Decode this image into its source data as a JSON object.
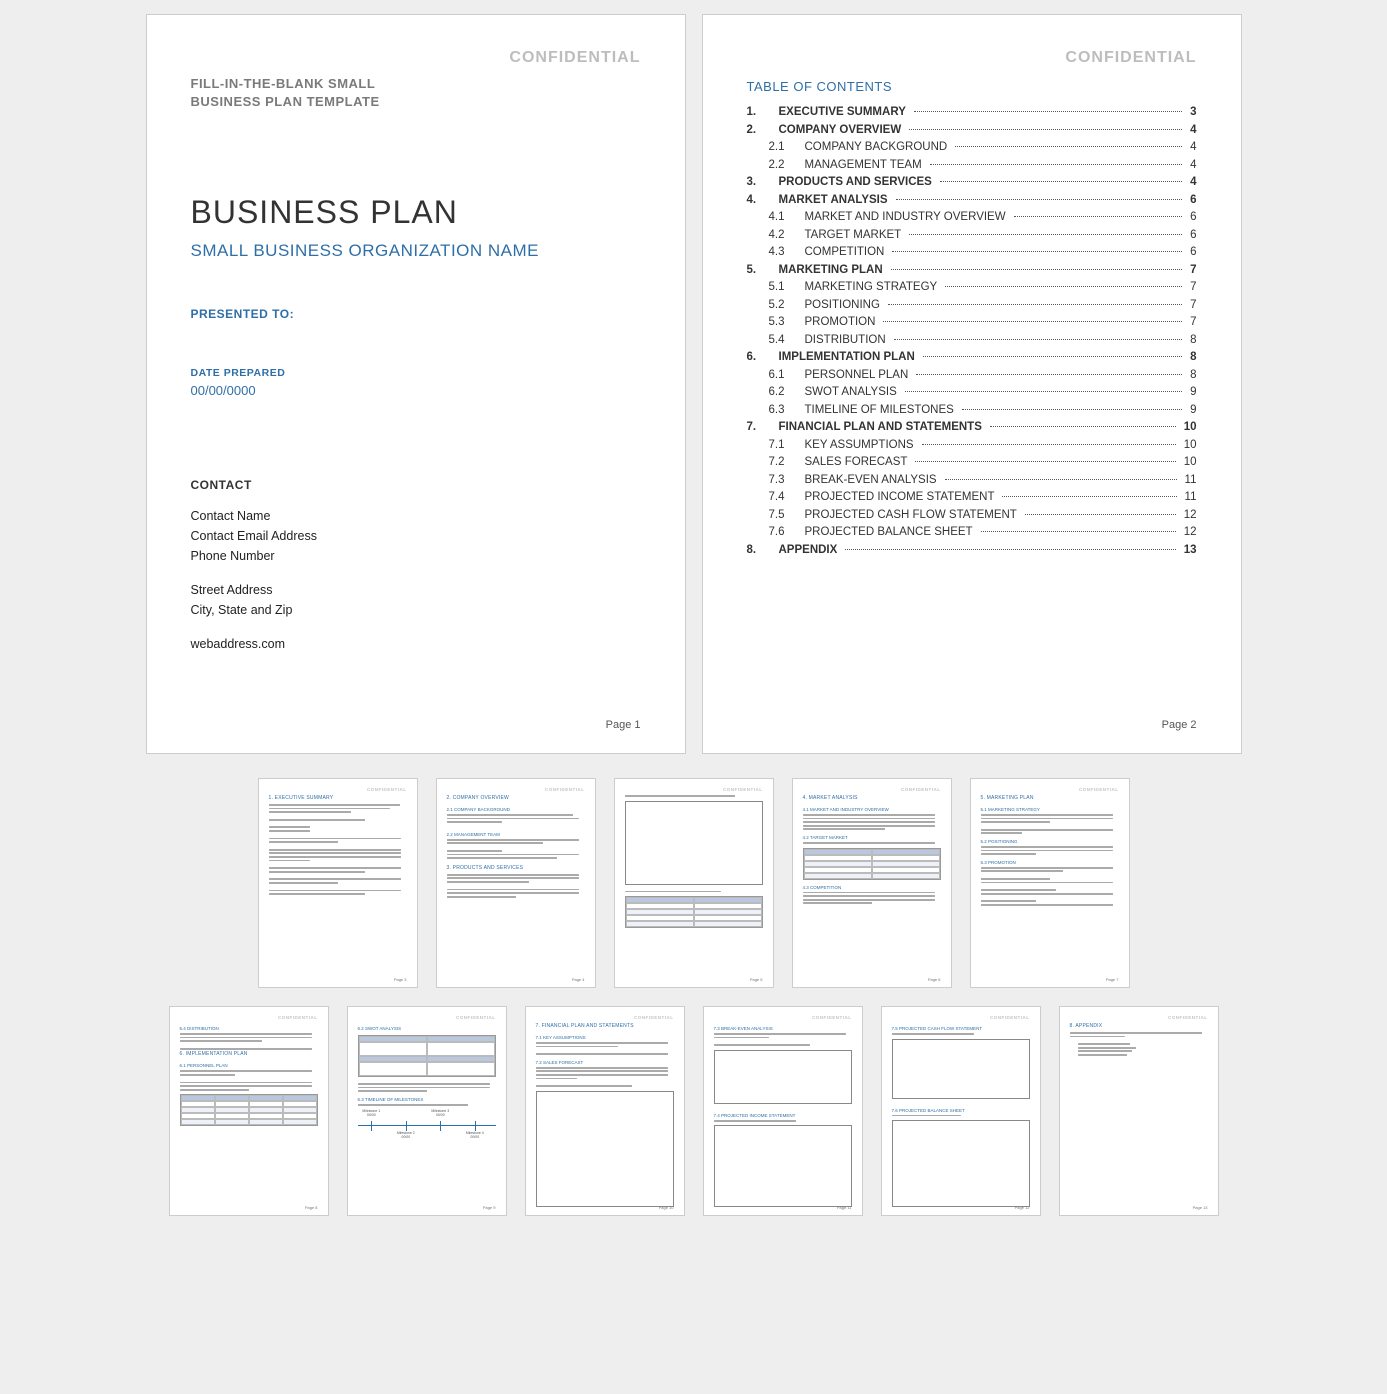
{
  "confidential": "CONFIDENTIAL",
  "page1": {
    "template_name": "FILL-IN-THE-BLANK SMALL BUSINESS PLAN TEMPLATE",
    "title": "BUSINESS PLAN",
    "org_name": "SMALL BUSINESS ORGANIZATION NAME",
    "presented_to_label": "PRESENTED TO:",
    "date_label": "DATE PREPARED",
    "date_value": "00/00/0000",
    "contact_label": "CONTACT",
    "contact": {
      "name": "Contact Name",
      "email": "Contact Email Address",
      "phone": "Phone Number",
      "street": "Street Address",
      "city": "City, State and Zip",
      "web": "webaddress.com"
    },
    "page_num": "Page 1"
  },
  "page2": {
    "toc_title": "TABLE OF CONTENTS",
    "entries": [
      {
        "num": "1.",
        "label": "EXECUTIVE SUMMARY",
        "page": "3",
        "level": 1
      },
      {
        "num": "2.",
        "label": "COMPANY OVERVIEW",
        "page": "4",
        "level": 1
      },
      {
        "num": "2.1",
        "label": "COMPANY BACKGROUND",
        "page": "4",
        "level": 2
      },
      {
        "num": "2.2",
        "label": "MANAGEMENT TEAM",
        "page": "4",
        "level": 2
      },
      {
        "num": "3.",
        "label": "PRODUCTS AND SERVICES",
        "page": "4",
        "level": 1
      },
      {
        "num": "4.",
        "label": "MARKET ANALYSIS",
        "page": "6",
        "level": 1
      },
      {
        "num": "4.1",
        "label": "MARKET AND INDUSTRY OVERVIEW",
        "page": "6",
        "level": 2
      },
      {
        "num": "4.2",
        "label": "TARGET MARKET",
        "page": "6",
        "level": 2
      },
      {
        "num": "4.3",
        "label": "COMPETITION",
        "page": "6",
        "level": 2
      },
      {
        "num": "5.",
        "label": "MARKETING PLAN",
        "page": "7",
        "level": 1
      },
      {
        "num": "5.1",
        "label": "MARKETING STRATEGY",
        "page": "7",
        "level": 2
      },
      {
        "num": "5.2",
        "label": "POSITIONING",
        "page": "7",
        "level": 2
      },
      {
        "num": "5.3",
        "label": "PROMOTION",
        "page": "7",
        "level": 2
      },
      {
        "num": "5.4",
        "label": "DISTRIBUTION",
        "page": "8",
        "level": 2
      },
      {
        "num": "6.",
        "label": "IMPLEMENTATION PLAN",
        "page": "8",
        "level": 1
      },
      {
        "num": "6.1",
        "label": "PERSONNEL PLAN",
        "page": "8",
        "level": 2
      },
      {
        "num": "6.2",
        "label": "SWOT ANALYSIS",
        "page": "9",
        "level": 2
      },
      {
        "num": "6.3",
        "label": "TIMELINE OF MILESTONES",
        "page": "9",
        "level": 2
      },
      {
        "num": "7.",
        "label": "FINANCIAL PLAN AND STATEMENTS",
        "page": "10",
        "level": 1
      },
      {
        "num": "7.1",
        "label": "KEY ASSUMPTIONS",
        "page": "10",
        "level": 2
      },
      {
        "num": "7.2",
        "label": "SALES FORECAST",
        "page": "10",
        "level": 2
      },
      {
        "num": "7.3",
        "label": "BREAK-EVEN ANALYSIS",
        "page": "11",
        "level": 2
      },
      {
        "num": "7.4",
        "label": "PROJECTED INCOME STATEMENT",
        "page": "11",
        "level": 2
      },
      {
        "num": "7.5",
        "label": "PROJECTED CASH FLOW STATEMENT",
        "page": "12",
        "level": 2
      },
      {
        "num": "7.6",
        "label": "PROJECTED BALANCE SHEET",
        "page": "12",
        "level": 2
      },
      {
        "num": "8.",
        "label": "APPENDIX",
        "page": "13",
        "level": 1
      }
    ],
    "page_num": "Page 2"
  },
  "thumbs": {
    "row1": [
      {
        "h": "1.  EXECUTIVE SUMMARY",
        "pn": "Page 3"
      },
      {
        "h": "2.  COMPANY OVERVIEW",
        "pn": "Page 4"
      },
      {
        "h": "",
        "pn": "Page 5"
      },
      {
        "h": "4.  MARKET ANALYSIS",
        "pn": "Page 6"
      },
      {
        "h": "5.  MARKETING PLAN",
        "pn": "Page 7"
      }
    ],
    "row2": [
      {
        "h": "5.4  DISTRIBUTION",
        "pn": "Page 8"
      },
      {
        "h": "6.2  SWOT ANALYSIS",
        "pn": "Page 9"
      },
      {
        "h": "7.  FINANCIAL PLAN AND STATEMENTS",
        "pn": "Page 10"
      },
      {
        "h": "7.3  BREAK-EVEN ANALYSIS",
        "pn": "Page 11"
      },
      {
        "h": "7.5  PROJECTED CASH FLOW STATEMENT",
        "pn": "Page 12"
      },
      {
        "h": "8.  APPENDIX",
        "pn": "Page 13"
      }
    ]
  }
}
